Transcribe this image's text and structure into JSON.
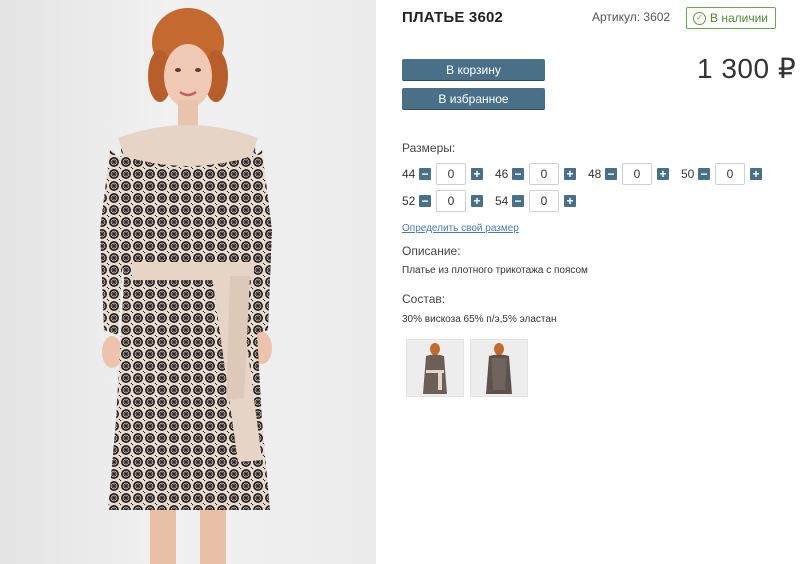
{
  "product": {
    "title": "ПЛАТЬЕ 3602",
    "sku": "Артикул: 3602",
    "stock": "В наличии",
    "price": "1 300 ₽"
  },
  "actions": {
    "cart_label": "В корзину",
    "favorite_label": "В избранное"
  },
  "sizes": {
    "label": "Размеры:",
    "items": [
      {
        "size": "44",
        "qty": "0"
      },
      {
        "size": "46",
        "qty": "0"
      },
      {
        "size": "48",
        "qty": "0"
      },
      {
        "size": "50",
        "qty": "0"
      },
      {
        "size": "52",
        "qty": "0"
      },
      {
        "size": "54",
        "qty": "0"
      }
    ],
    "minus": "−",
    "plus": "+",
    "size_link": "Определить свой размер"
  },
  "description": {
    "label": "Описание:",
    "text": "Платье из плотного трикотажа с поясом"
  },
  "composition": {
    "label": "Состав:",
    "text": "30% вискоза 65% п/э,5% эластан"
  },
  "colors": {
    "accent": "#4a7088",
    "stock_green": "#4f8a2f",
    "link": "#4a7ab0"
  },
  "icons": {
    "stock": "check-circle-icon"
  }
}
